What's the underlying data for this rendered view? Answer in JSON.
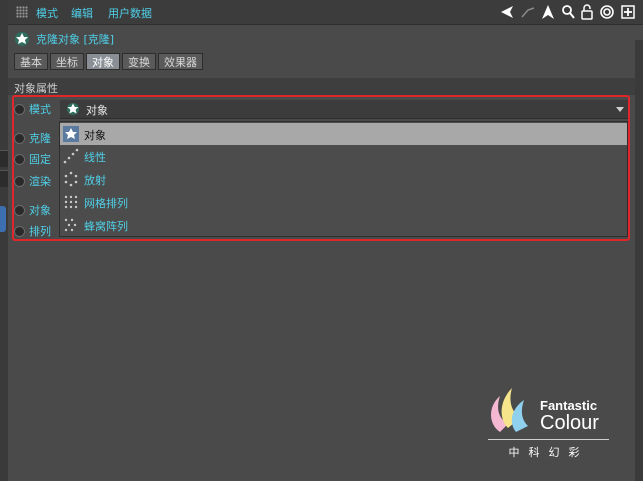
{
  "menubar": {
    "items": [
      "模式",
      "编辑",
      "用户数据"
    ]
  },
  "object": {
    "title": "克隆对象 [克隆]"
  },
  "tabs": [
    {
      "label": "基本",
      "active": false
    },
    {
      "label": "坐标",
      "active": false
    },
    {
      "label": "对象",
      "active": true
    },
    {
      "label": "变换",
      "active": false
    },
    {
      "label": "效果器",
      "active": false
    }
  ],
  "section": {
    "title": "对象属性"
  },
  "params": {
    "mode_label": "模式",
    "mode_value": "对象",
    "hidden_labels": [
      "克隆",
      "固定",
      "渲染",
      "对象",
      "排列"
    ]
  },
  "dropdown": {
    "options": [
      {
        "label": "对象",
        "icon": "cloner-object-icon",
        "selected": true
      },
      {
        "label": "线性",
        "icon": "linear-icon",
        "selected": false
      },
      {
        "label": "放射",
        "icon": "radial-icon",
        "selected": false
      },
      {
        "label": "网格排列",
        "icon": "grid-icon",
        "selected": false
      },
      {
        "label": "蜂窝阵列",
        "icon": "honeycomb-icon",
        "selected": false
      }
    ]
  },
  "watermark": {
    "brand_line1": "Fantastic",
    "brand_line2": "Colour",
    "cn": "中科幻彩"
  },
  "colors": {
    "accent": "#4fd0e8",
    "highlight": "#e0262a",
    "panel": "#4a4a4a"
  }
}
